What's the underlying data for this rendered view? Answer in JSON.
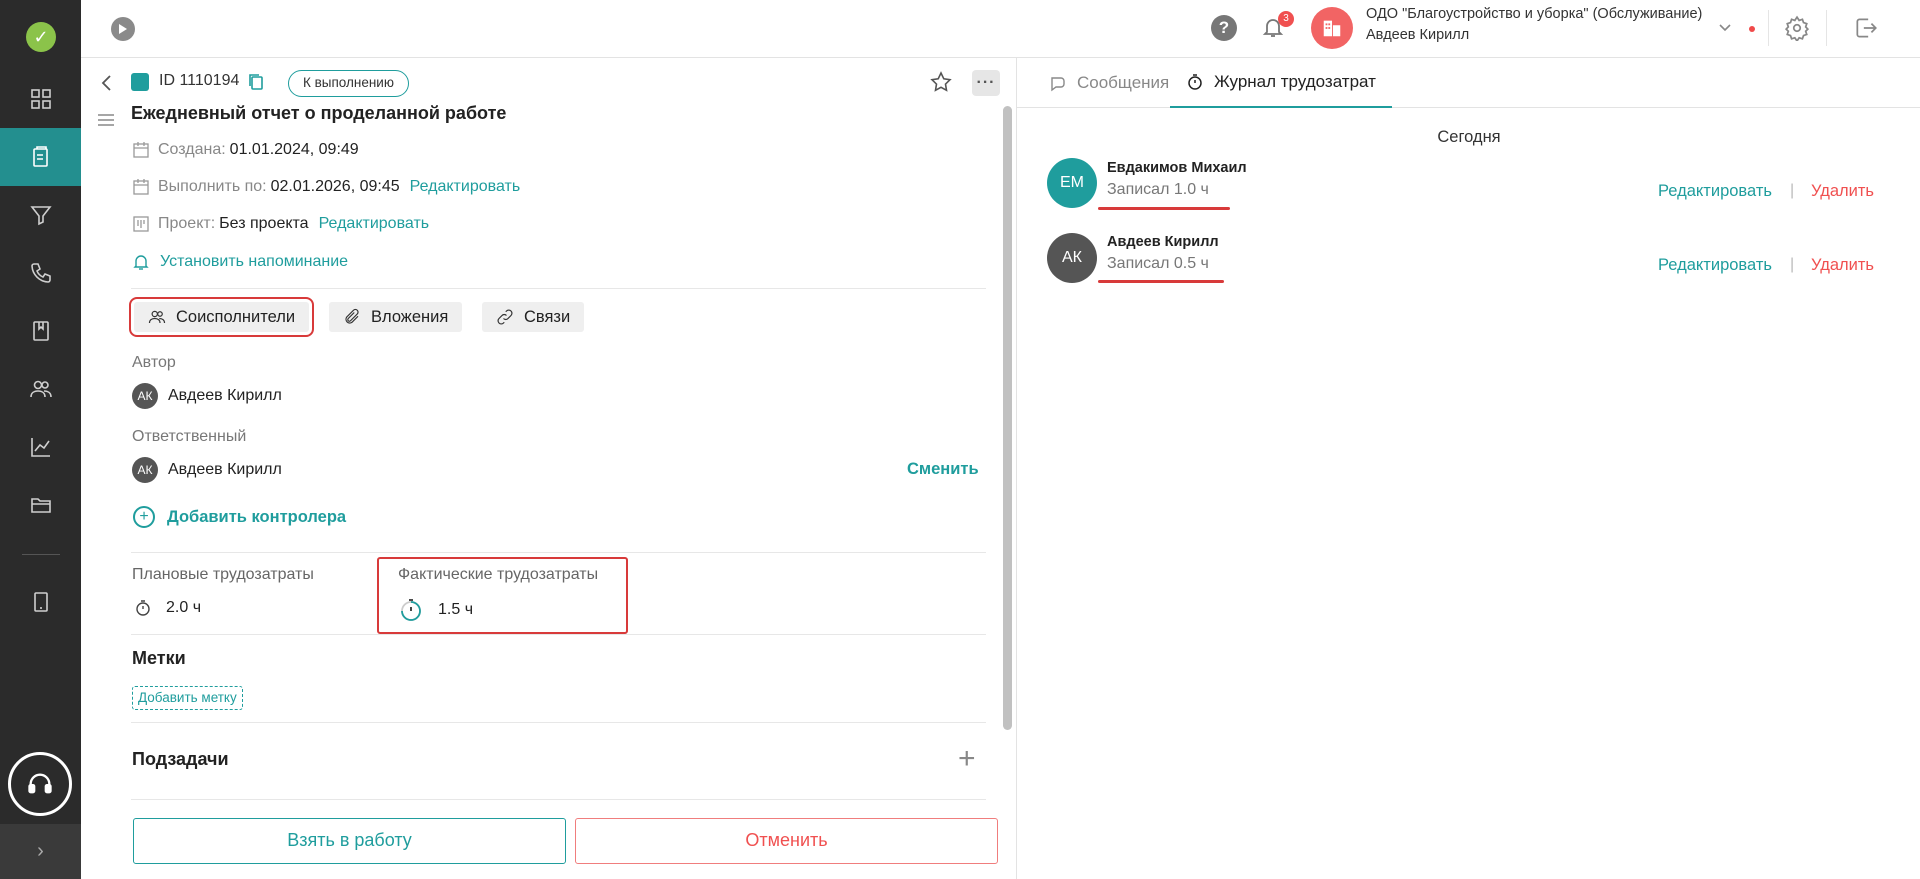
{
  "colors": {
    "accent": "#1f9d9d",
    "danger": "#f05050",
    "sidebar_bg": "#2b2b2b",
    "highlight": "#d83a3a"
  },
  "sidebar": {
    "items": [
      {
        "icon": "dashboard-icon"
      },
      {
        "icon": "tasks-icon",
        "active": true
      },
      {
        "icon": "filter-icon"
      },
      {
        "icon": "phone-icon"
      },
      {
        "icon": "book-icon"
      },
      {
        "icon": "users-icon"
      },
      {
        "icon": "analytics-icon"
      },
      {
        "icon": "folder-icon"
      },
      {
        "icon": "tablet-icon"
      }
    ]
  },
  "topbar": {
    "notifications_count": "3",
    "org_name": "ОДО \"Благоустройство и уборка\" (Обслуживание)",
    "user_name": "Авдеев Кирилл"
  },
  "task": {
    "id": "ID 1110194",
    "status": "К выполнению",
    "title": "Ежедневный отчет о проделанной работе",
    "created_label": "Создана:",
    "created_value": "01.01.2024, 09:49",
    "due_label": "Выполнить по:",
    "due_value": "02.01.2026, 09:45",
    "due_edit": "Редактировать",
    "project_label": "Проект:",
    "project_value": "Без проекта",
    "project_edit": "Редактировать",
    "reminder": "Установить напоминание",
    "chips": {
      "coexecutors": "Соисполнители",
      "attachments": "Вложения",
      "links": "Связи"
    },
    "author_label": "Автор",
    "author": {
      "initials": "АК",
      "name": "Авдеев Кирилл"
    },
    "responsible_label": "Ответственный",
    "responsible": {
      "initials": "АК",
      "name": "Авдеев Кирилл"
    },
    "change": "Сменить",
    "add_controller": "Добавить контролера",
    "planned_label": "Плановые трудозатраты",
    "planned_value": "2.0 ч",
    "actual_label": "Фактические трудозатраты",
    "actual_value": "1.5 ч",
    "tags_title": "Метки",
    "add_tag": "Добавить метку",
    "subtasks_title": "Подзадачи",
    "take_button": "Взять в работу",
    "cancel_button": "Отменить"
  },
  "right_panel": {
    "tabs": [
      {
        "label": "Сообщения"
      },
      {
        "label": "Журнал трудозатрат"
      }
    ],
    "day": "Сегодня",
    "entries": [
      {
        "initials": "ЕМ",
        "name": "Евдакимов Михаил",
        "text": "Записал 1.0 ч",
        "edit": "Редактировать",
        "sep": "|",
        "delete": "Удалить",
        "avatar_color": "#1f9d9d"
      },
      {
        "initials": "АК",
        "name": "Авдеев Кирилл",
        "text": "Записал 0.5 ч",
        "edit": "Редактировать",
        "sep": "|",
        "delete": "Удалить",
        "avatar_color": "#555555"
      }
    ]
  }
}
